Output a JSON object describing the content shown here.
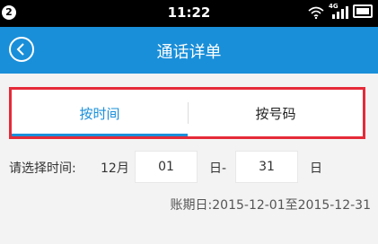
{
  "status_bar": {
    "badge": "2",
    "time": "11:22",
    "network": "4G",
    "icons": [
      "wifi-icon",
      "signal-icon",
      "battery-icon"
    ]
  },
  "header": {
    "title": "通话详单",
    "back_icon": "back-circle-icon"
  },
  "tabs": [
    {
      "label": "按时间",
      "active": true
    },
    {
      "label": "按号码",
      "active": false
    }
  ],
  "date_filter": {
    "prompt": "请选择时间:",
    "month": "12月",
    "from_day": "01",
    "separator": "日-",
    "to_day": "31",
    "suffix": "日"
  },
  "billing_period": "账期日:2015-12-01至2015-12-31",
  "colors": {
    "primary": "#1a8fd9",
    "highlight_border": "#e52a38",
    "background": "#f3f3f3"
  }
}
